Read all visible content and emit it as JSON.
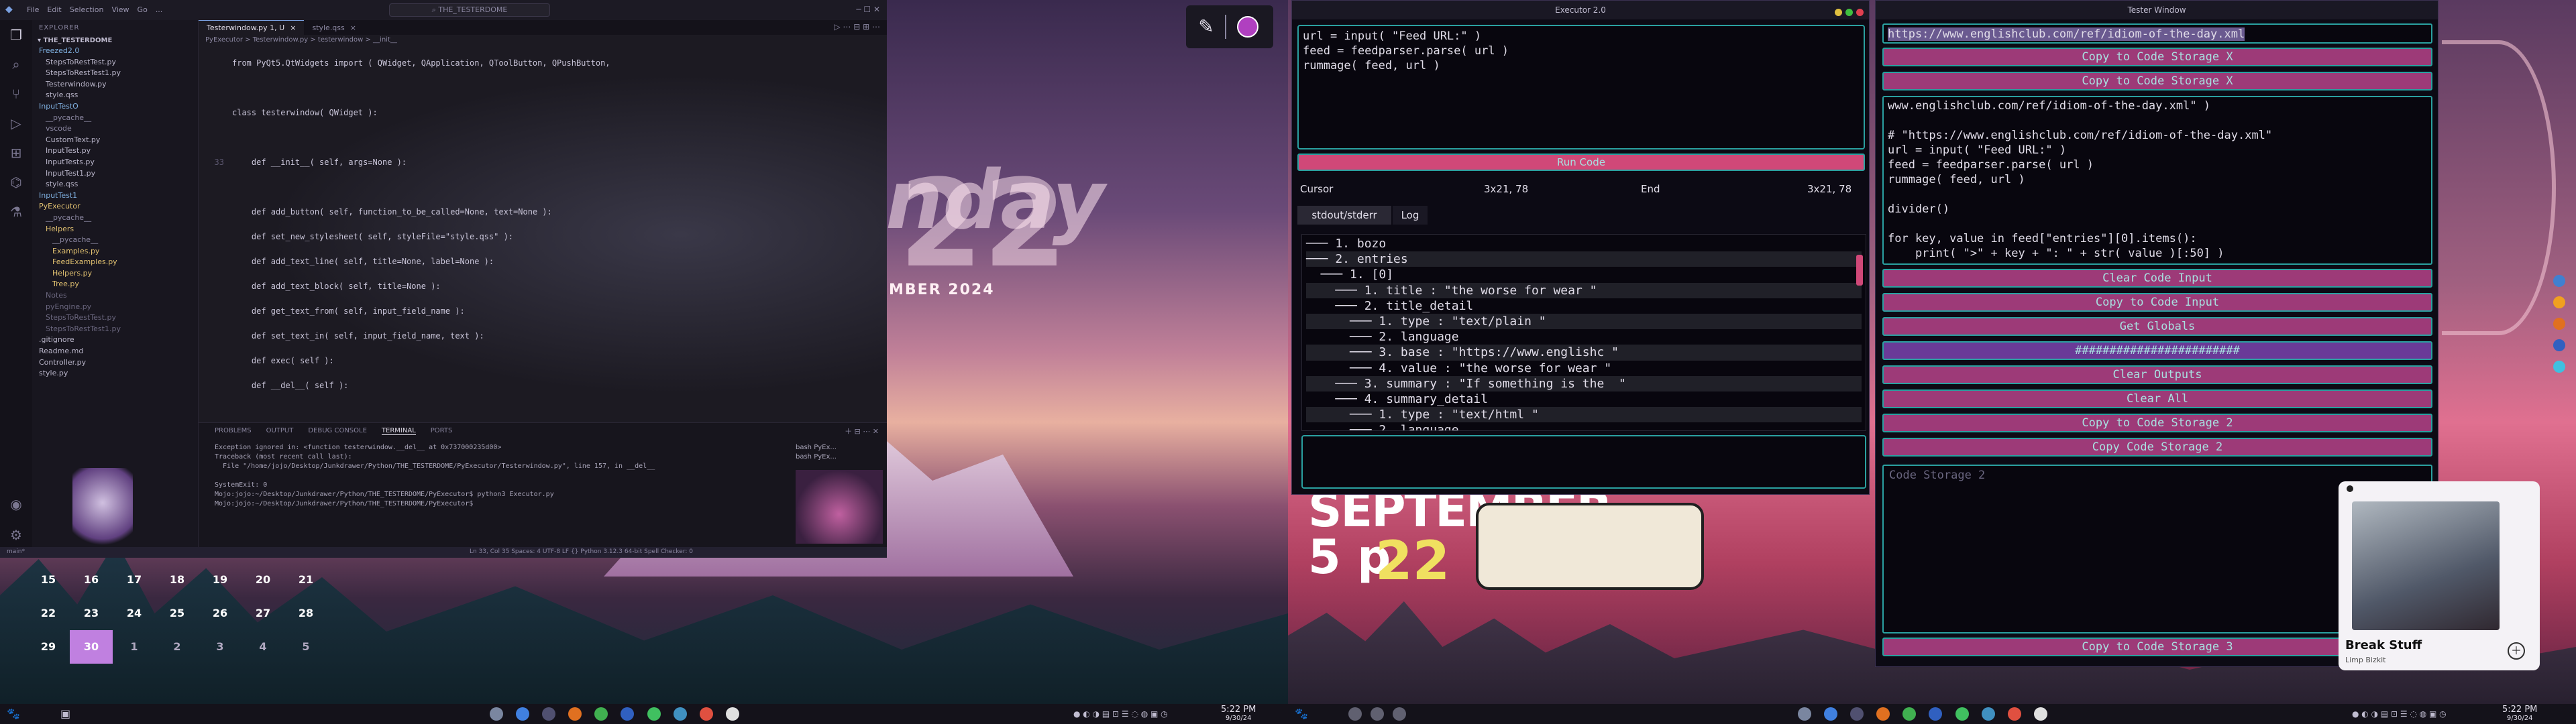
{
  "left_wallpaper": {
    "big_text": "nday",
    "big_num": "22",
    "sub_text": "MBER 2024"
  },
  "right_wallpaper": {
    "big_text": "SEPTEMBER",
    "sub_text": "5 p",
    "sub_num": "22"
  },
  "colors": {
    "accent_teal": "#2aa0a0",
    "button_magenta": "#9d3a78",
    "button_purple": "#6a3a98",
    "run_button": "#d04878"
  },
  "vscode": {
    "menu": [
      "File",
      "Edit",
      "Selection",
      "View",
      "Go",
      "..."
    ],
    "search": "THE_TESTERDOME",
    "tabs": [
      {
        "label": "Testerwindow.py 1, U",
        "active": true
      },
      {
        "label": "style.qss",
        "active": false
      }
    ],
    "breadcrumb": "PyExecutor > Testerwindow.py > testerwindow > __init__",
    "explorer_title": "EXPLORER",
    "project": "THE_TESTERDOME",
    "tree": [
      {
        "label": "Freezed2.0",
        "indent": 1,
        "color": "#7fb0e0"
      },
      {
        "label": "StepsToRestTest.py",
        "indent": 2,
        "color": "#b8b4c8"
      },
      {
        "label": "StepsToRestTest1.py",
        "indent": 2,
        "color": "#b8b4c8"
      },
      {
        "label": "Testerwindow.py",
        "indent": 2,
        "color": "#b8b4c8"
      },
      {
        "label": "style.qss",
        "indent": 2,
        "color": "#b8b4c8"
      },
      {
        "label": "InputTestO",
        "indent": 1,
        "color": "#7fb0e0"
      },
      {
        "label": "__pycache__",
        "indent": 2,
        "color": "#8a86a0"
      },
      {
        "label": "vscode",
        "indent": 2,
        "color": "#8a86a0"
      },
      {
        "label": "CustomText.py",
        "indent": 2,
        "color": "#b8b4c8"
      },
      {
        "label": "InputTest.py",
        "indent": 2,
        "color": "#b8b4c8"
      },
      {
        "label": "InputTests.py",
        "indent": 2,
        "color": "#b8b4c8"
      },
      {
        "label": "InputTest1.py",
        "indent": 2,
        "color": "#b8b4c8"
      },
      {
        "label": "style.qss",
        "indent": 2,
        "color": "#b8b4c8"
      },
      {
        "label": "InputTest1",
        "indent": 1,
        "color": "#7fb0e0"
      },
      {
        "label": "PyExecutor",
        "indent": 1,
        "color": "#e0c070"
      },
      {
        "label": "__pycache__",
        "indent": 2,
        "color": "#8a86a0"
      },
      {
        "label": "Helpers",
        "indent": 2,
        "color": "#e0c070"
      },
      {
        "label": "__pycache__",
        "indent": 3,
        "color": "#8a86a0"
      },
      {
        "label": "Examples.py",
        "indent": 3,
        "color": "#e0c070"
      },
      {
        "label": "FeedExamples.py",
        "indent": 3,
        "color": "#e0c070"
      },
      {
        "label": "Helpers.py",
        "indent": 3,
        "color": "#e0c070"
      },
      {
        "label": "Tree.py",
        "indent": 3,
        "color": "#e0c070"
      },
      {
        "label": "Notes",
        "indent": 2,
        "color": "#6a667e"
      },
      {
        "label": "pyEngine.py",
        "indent": 2,
        "color": "#6a667e"
      },
      {
        "label": "StepsToRestTest.py",
        "indent": 2,
        "color": "#6a667e"
      },
      {
        "label": "StepsToRestTest1.py",
        "indent": 2,
        "color": "#6a667e"
      },
      {
        "label": ".gitignore",
        "indent": 1,
        "color": "#b8b4c8"
      },
      {
        "label": "Readme.md",
        "indent": 1,
        "color": "#b8b4c8"
      },
      {
        "label": "Controller.py",
        "indent": 1,
        "color": "#b8b4c8"
      },
      {
        "label": "style.py",
        "indent": 1,
        "color": "#b8b4c8"
      }
    ],
    "code": [
      {
        "n": "",
        "html": "from PyQt5.QtWidgets import ( QWidget, QApplication, QToolButton, QPushButton,"
      },
      {
        "n": "",
        "html": ""
      },
      {
        "n": "",
        "html": "class testerwindow( QWidget ):"
      },
      {
        "n": "",
        "html": "    "
      },
      {
        "n": "33",
        "html": "    def __init__( self, args=None ):"
      },
      {
        "n": "",
        "html": ""
      },
      {
        "n": "",
        "html": "    def add_button( self, function_to_be_called=None, text=None ):"
      },
      {
        "n": "",
        "html": "    def set_new_stylesheet( self, styleFile=\"style.qss\" ):"
      },
      {
        "n": "",
        "html": "    def add_text_line( self, title=None, label=None ):"
      },
      {
        "n": "",
        "html": "    def add_text_block( self, title=None ):"
      },
      {
        "n": "",
        "html": "    def get_text_from( self, input_field_name ):"
      },
      {
        "n": "",
        "html": "    def set_text_in( self, input_field_name, text ):"
      },
      {
        "n": "",
        "html": "    def exec( self ):"
      },
      {
        "n": "",
        "html": "    def __del__( self ):"
      }
    ],
    "panel_tabs": [
      "PROBLEMS",
      "OUTPUT",
      "DEBUG CONSOLE",
      "TERMINAL",
      "PORTS"
    ],
    "terminal": [
      "Exception ignored in: <function testerwindow.__del__ at 0x737000235d00>",
      "Traceback (most recent call last):",
      "  File \"/home/jojo/Desktop/Junkdrawer/Python/THE_TESTERDOME/PyExecutor/Testerwindow.py\", line 157, in __del__",
      "",
      "SystemExit: 0",
      "Mojo:jojo:~/Desktop/Junkdrawer/Python/THE_TESTERDOME/PyExecutor$ python3 Executor.py",
      "Mojo:jojo:~/Desktop/Junkdrawer/Python/THE_TESTERDOME/PyExecutor$ "
    ],
    "terminal_list": [
      "bash PyEx...",
      "bash PyEx..."
    ],
    "status_left": "main*",
    "status_right": "Ln 33, Col 35  Spaces: 4  UTF-8  LF  {} Python  3.12.3 64-bit  Spell Checker: 0"
  },
  "calendar": {
    "rows": [
      [
        "15",
        "16",
        "17",
        "18",
        "19",
        "20",
        "21"
      ],
      [
        "22",
        "23",
        "24",
        "25",
        "26",
        "27",
        "28"
      ],
      [
        "29",
        "30",
        "1",
        "2",
        "3",
        "4",
        "5"
      ]
    ],
    "today": "30"
  },
  "color_picker": {
    "eyedropper": "eyedropper-icon",
    "swatch": "#b040c0"
  },
  "executor": {
    "title": "Executor 2.0",
    "code_lines": [
      "url = input( \"Feed URL:\" )",
      "feed = feedparser.parse( url )",
      "rummage( feed, url )"
    ],
    "run_label": "Run Code",
    "cursor_label": "Cursor",
    "cursor_pos": "3x21, 78",
    "end_label": "End",
    "end_pos": "3x21, 78",
    "tabs": [
      "stdout/stderr",
      "Log"
    ],
    "tree": [
      "─── 1. bozo",
      "─── 2. entries",
      "  ─── 1. [0]",
      "    ─── 1. title : \"the worse for wear \"",
      "    ─── 2. title_detail",
      "      ─── 1. type : \"text/plain \"",
      "      ─── 2. language",
      "      ─── 3. base : \"https://www.englishc \"",
      "      ─── 4. value : \"the worse for wear \"",
      "    ─── 3. summary : \"If something is the  \"",
      "    ─── 4. summary_detail",
      "      ─── 1. type : \"text/html \"",
      "      ─── 2. language"
    ]
  },
  "tester": {
    "title": "Tester Window",
    "url_value": "https://www.englishclub.com/ref/idiom-of-the-day.xml",
    "buttons_top": [
      "Copy to Code Storage X",
      "Copy to Code Storage X"
    ],
    "code_block": [
      "www.englishclub.com/ref/idiom-of-the-day.xml\" )",
      "",
      "# \"https://www.englishclub.com/ref/idiom-of-the-day.xml\"",
      "url = input( \"Feed URL:\" )",
      "feed = feedparser.parse( url )",
      "rummage( feed, url )",
      "",
      "divider()",
      "",
      "for key, value in feed[\"entries\"][0].items():",
      "    print( \">\" + key + \": \" + str( value )[:50] )"
    ],
    "buttons_mid": [
      "Clear Code Input",
      "Copy to Code Input",
      "Get Globals",
      "########################",
      "Clear Outputs",
      "Clear All",
      "Copy to Code Storage 2",
      "Copy Code Storage 2"
    ],
    "storage_placeholder": "Code Storage 2",
    "button_bottom": "Copy to Code Storage 3"
  },
  "media": {
    "title": "Break Stuff",
    "artist": "Limp Bizkit"
  },
  "left_taskbar": {
    "time": "5:22 PM",
    "date": "9/30/24"
  },
  "right_taskbar": {
    "time": "5:22 PM",
    "date": "9/30/24"
  }
}
